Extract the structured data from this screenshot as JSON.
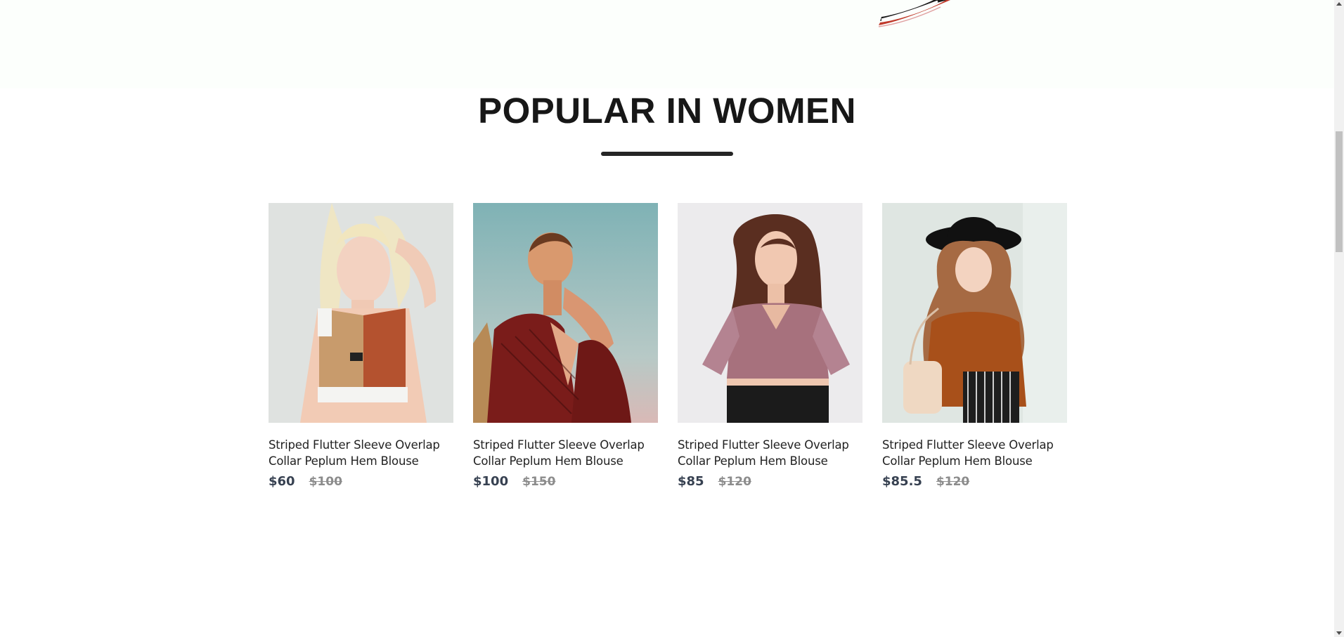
{
  "section": {
    "title": "POPULAR IN WOMEN"
  },
  "products": [
    {
      "title": "Striped Flutter Sleeve Overlap Collar Peplum Hem Blouse",
      "price_new": "$60",
      "price_old": "$100"
    },
    {
      "title": "Striped Flutter Sleeve Overlap Collar Peplum Hem Blouse",
      "price_new": "$100",
      "price_old": "$150"
    },
    {
      "title": "Striped Flutter Sleeve Overlap Collar Peplum Hem Blouse",
      "price_new": "$85",
      "price_old": "$120"
    },
    {
      "title": "Striped Flutter Sleeve Overlap Collar Peplum Hem Blouse",
      "price_new": "$85.5",
      "price_old": "$120"
    }
  ],
  "colors": {
    "title": "#171717",
    "underline": "#252525",
    "price_new": "#374151",
    "price_old": "#8c8c8c",
    "hero_bg": "#fcfffc"
  }
}
